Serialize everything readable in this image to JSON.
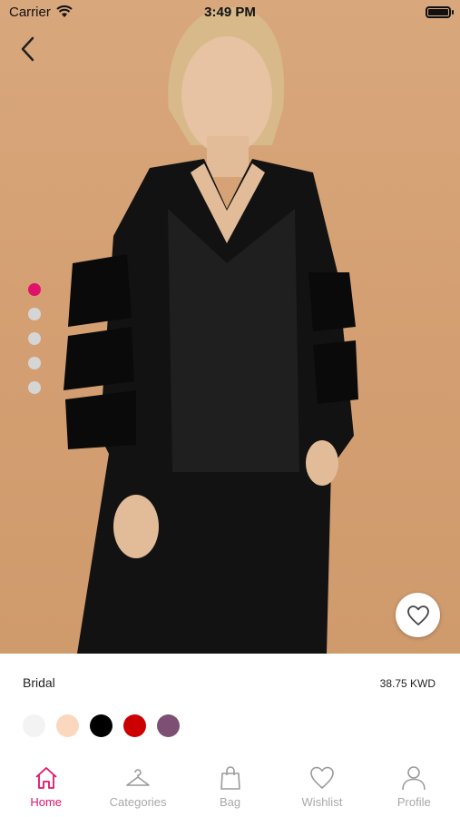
{
  "status_bar": {
    "carrier": "Carrier",
    "time": "3:49 PM"
  },
  "carousel": {
    "image_count": 5,
    "active_index": 0,
    "accent_color": "#e0126a"
  },
  "product": {
    "name": "Bridal",
    "price": "38.75 KWD"
  },
  "colors": [
    "#f3f3f3",
    "#fbd7bd",
    "#000000",
    "#cc0000",
    "#7e4f74"
  ],
  "tabs": [
    {
      "label": "Home",
      "icon": "home-icon",
      "active": true
    },
    {
      "label": "Categories",
      "icon": "hanger-icon",
      "active": false
    },
    {
      "label": "Bag",
      "icon": "bag-icon",
      "active": false
    },
    {
      "label": "Wishlist",
      "icon": "heart-icon",
      "active": false
    },
    {
      "label": "Profile",
      "icon": "person-icon",
      "active": false
    }
  ]
}
